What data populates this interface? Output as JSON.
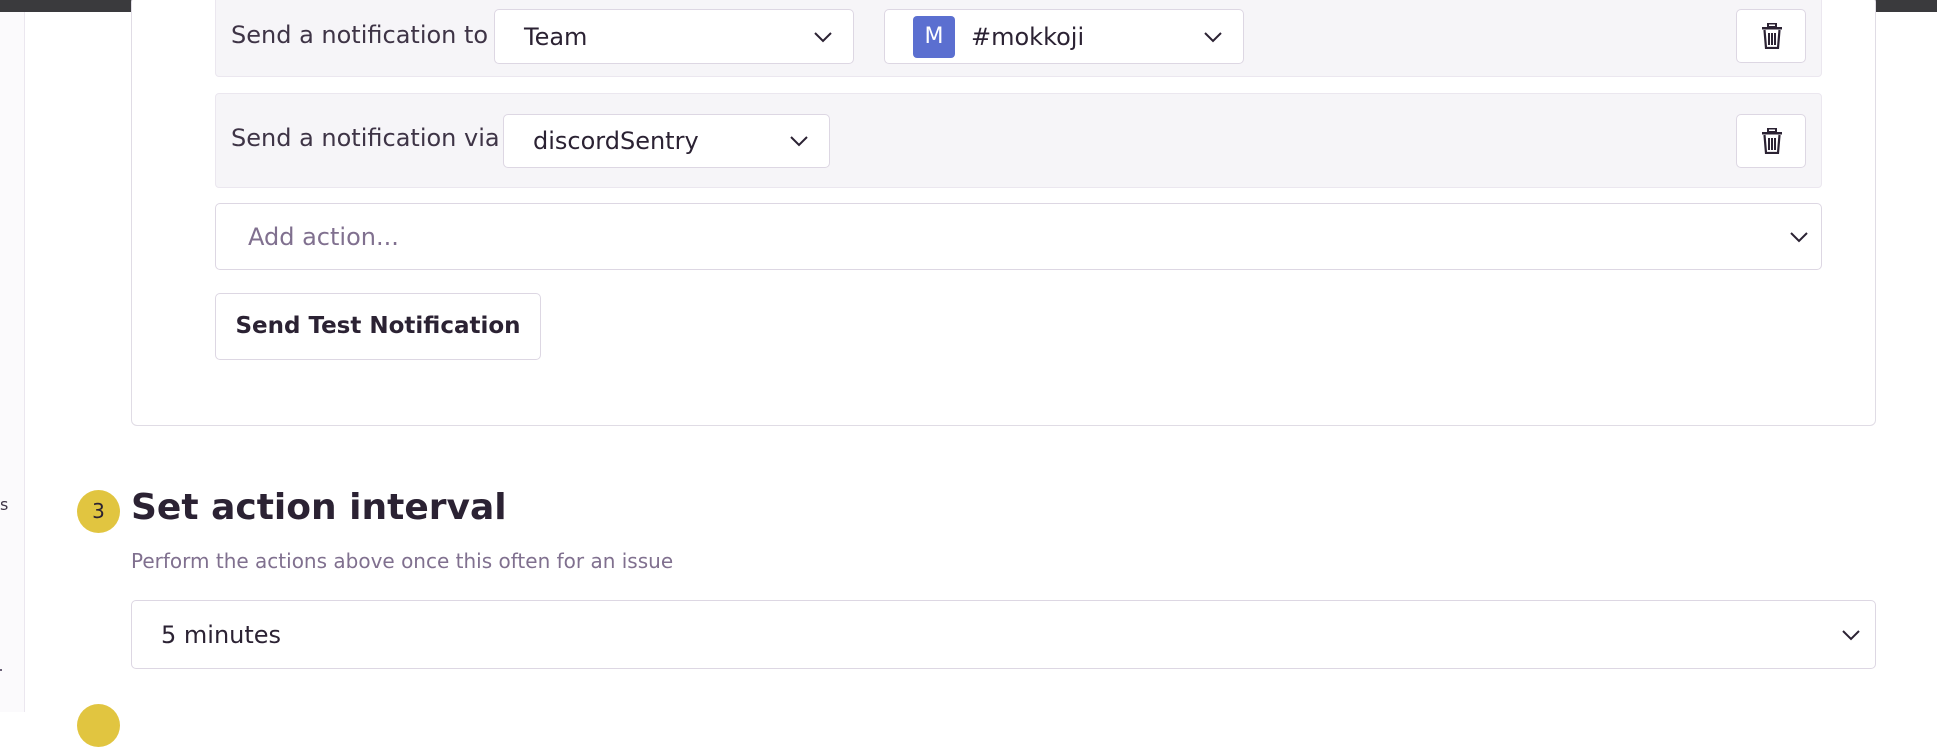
{
  "sidebar": {
    "fragment_text": "s"
  },
  "actions": {
    "row1": {
      "label": "Send a notification to",
      "target_value": "Team",
      "team_avatar_letter": "M",
      "team_value": "#mokkoji"
    },
    "row2": {
      "label": "Send a notification via",
      "service_value": "discordSentry"
    },
    "add_action_placeholder": "Add action...",
    "send_test_label": "Send Test Notification"
  },
  "step3": {
    "number": "3",
    "title": "Set action interval",
    "description": "Perform the actions above once this often for an issue",
    "interval_value": "5 minutes"
  },
  "colors": {
    "accent_badge": "#e1c540",
    "avatar_bg": "#5b6fd0",
    "placeholder_text": "#80708f"
  },
  "icons": [
    "chevron-down-icon",
    "trash-icon"
  ]
}
